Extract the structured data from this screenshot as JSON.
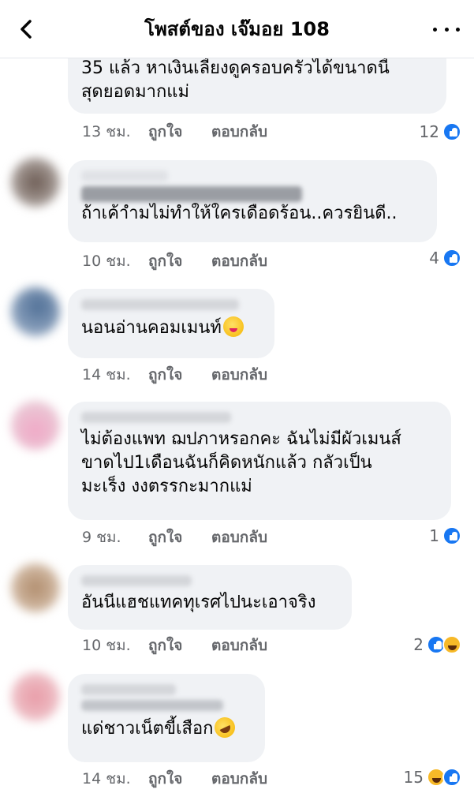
{
  "header": {
    "title": "โพสต์ของ เจ๊มอย 108",
    "back_icon": "chevron-left-icon",
    "more_icon": "more-horizontal-icon"
  },
  "actions": {
    "like": "ถูกใจ",
    "reply": "ตอบกลับ"
  },
  "comments": [
    {
      "lines": [
        "35 แล้ว หาเงินเลี้ยงดูครอบครัวได้ขนาดนี้",
        "สุดยอดมากแม่"
      ],
      "time": "13 ชม.",
      "reaction_count": "12",
      "reactions": [
        "like"
      ]
    },
    {
      "lines": [
        "ถ้าเค้าํามไม่ทำให้ใครเดือดร้อน..ควรยินดี.."
      ],
      "time": "10 ชม.",
      "reaction_count": "4",
      "reactions": [
        "like"
      ]
    },
    {
      "lines": [
        "นอนอ่านคอมเมนท์"
      ],
      "emoji": "yum-face",
      "time": "14 ชม.",
      "reaction_count": "",
      "reactions": []
    },
    {
      "lines": [
        "ไม่ต้องแพท ฌปภาหรอกคะ ฉันไม่มีผัวเมนส์",
        "ขาดไป1เดือนฉันก็คิดหนักแล้ว กลัวเป็น",
        "มะเร็ง งงตรรกะมากแม่"
      ],
      "time": "9 ชม.",
      "reaction_count": "1",
      "reactions": [
        "like"
      ]
    },
    {
      "lines": [
        "อันนีแฮชแทคทุเรศไปนะเอาจริง"
      ],
      "time": "10 ชม.",
      "reaction_count": "2",
      "reactions": [
        "like",
        "haha"
      ]
    },
    {
      "lines": [
        "แด่ชาวเน็ตขี้เสือก"
      ],
      "emoji": "rofl-face",
      "time": "14 ชม.",
      "reaction_count": "15",
      "reactions": [
        "haha",
        "like"
      ]
    }
  ]
}
